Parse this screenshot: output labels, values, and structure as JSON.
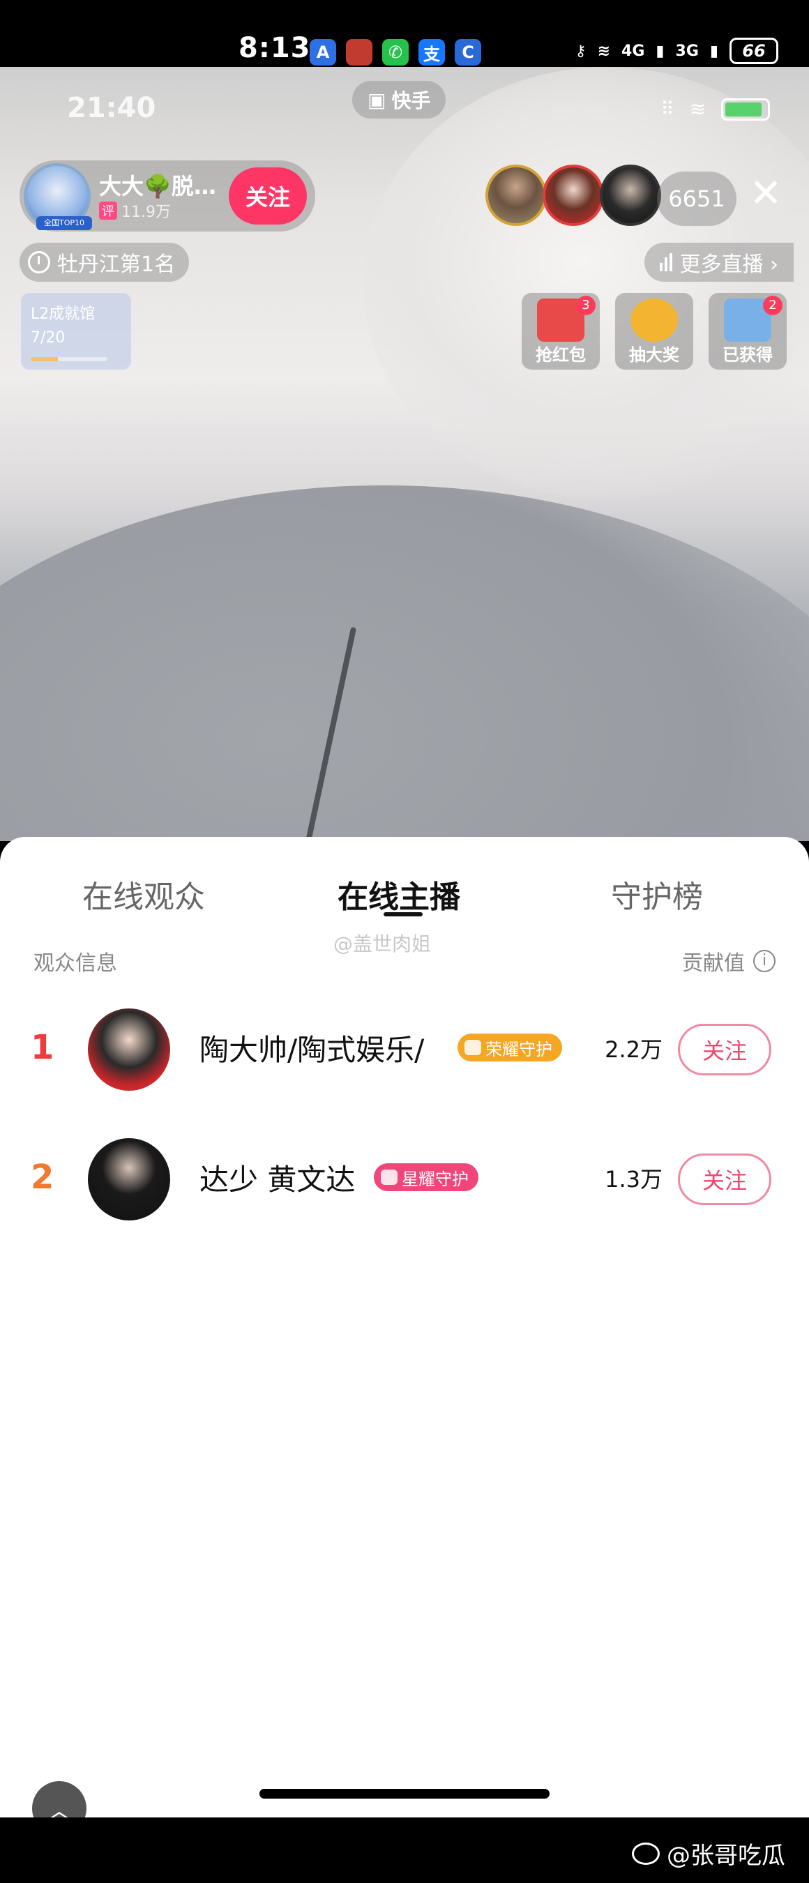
{
  "outer_status": {
    "time": "8:13",
    "app_icons": [
      {
        "icon": "a-app-icon",
        "glyph": "A",
        "color": "#2f6fe4"
      },
      {
        "icon": "red-app-icon",
        "glyph": "",
        "color": "#c23b2f"
      },
      {
        "icon": "wechat-icon",
        "glyph": "✆",
        "color": "#27c24c"
      },
      {
        "icon": "alipay-icon",
        "glyph": "支",
        "color": "#1677ff"
      },
      {
        "icon": "c-app-icon",
        "glyph": "C",
        "color": "#2a6ad8"
      }
    ],
    "signal1": "4G",
    "signal2": "3G",
    "battery": "66"
  },
  "inner_status": {
    "time": "21:40",
    "app_name": "快手"
  },
  "host": {
    "name": "大大🌳脱…",
    "fans": "11.9万",
    "ping_tag": "评",
    "avatar_badge": "全国TOP10",
    "follow_label": "关注"
  },
  "viewer_count": "6651",
  "rank_label": "牡丹江第1名",
  "more_live_label": "更多直播 ›",
  "l2_card": {
    "title": "L2成就馆",
    "progress": "7/20",
    "fraction": 0.35
  },
  "activities": [
    {
      "label": "抢红包",
      "badge": "3",
      "icon": "red-envelope-icon",
      "color": "#e84a4a"
    },
    {
      "label": "抽大奖",
      "badge": "",
      "icon": "lottery-wheel-icon",
      "color": "#f3b431"
    },
    {
      "label": "已获得",
      "badge": "2",
      "icon": "gift-box-icon",
      "color": "#7ab0e8"
    }
  ],
  "sheet": {
    "tabs": [
      "在线观众",
      "在线主播",
      "守护榜"
    ],
    "active_tab": 1,
    "watermark": "@盖世肉姐",
    "header_left": "观众信息",
    "header_right": "贡献值",
    "rows": [
      {
        "rank": "1",
        "name": "陶大帅/陶式娱乐/",
        "tag": "荣耀守护",
        "tag_color": "#f5a623",
        "value": "2.2万",
        "follow": "关注",
        "rank_color": "#ef3b3b"
      },
      {
        "rank": "2",
        "name": "达少 黄文达",
        "tag": "星耀守护",
        "tag_color": "#f0467a",
        "value": "1.3万",
        "follow": "关注",
        "rank_color": "#f07a32"
      }
    ]
  },
  "footer_credit": "@张哥吃瓜"
}
